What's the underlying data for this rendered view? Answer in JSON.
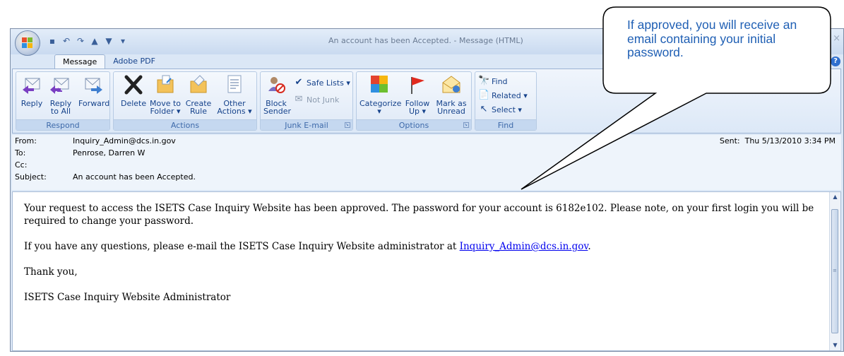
{
  "window": {
    "title": "An account has been Accepted. - Message (HTML)",
    "close_glyph": "×"
  },
  "quick_access": {
    "icons": [
      "save-icon",
      "undo-icon",
      "redo-icon",
      "previous-item-icon",
      "next-item-icon",
      "customize-dropdown-icon"
    ]
  },
  "tabs": [
    {
      "label": "Message",
      "active": true
    },
    {
      "label": "Adobe PDF",
      "active": false
    }
  ],
  "ribbon": {
    "respond": {
      "label": "Respond",
      "reply": "Reply",
      "reply_all": "Reply\nto All",
      "forward": "Forward"
    },
    "actions": {
      "label": "Actions",
      "delete": "Delete",
      "move": "Move to\nFolder ▾",
      "create_rule": "Create\nRule",
      "other_actions": "Other\nActions ▾"
    },
    "junk": {
      "label": "Junk E-mail",
      "block_sender": "Block\nSender",
      "safe_lists": "Safe Lists ▾",
      "not_junk": "Not Junk"
    },
    "options": {
      "label": "Options",
      "categorize": "Categorize\n▾",
      "follow_up": "Follow\nUp ▾",
      "mark_unread": "Mark as\nUnread"
    },
    "find": {
      "label": "Find",
      "find": "Find",
      "related": "Related ▾",
      "select": "Select ▾"
    }
  },
  "headers": {
    "from_label": "From:",
    "from_value": "Inquiry_Admin@dcs.in.gov",
    "to_label": "To:",
    "to_value": "Penrose, Darren W",
    "cc_label": "Cc:",
    "cc_value": "",
    "subject_label": "Subject:",
    "subject_value": "An account has been Accepted.",
    "sent_label": "Sent:",
    "sent_value": "Thu 5/13/2010 3:34 PM"
  },
  "body": {
    "para1": "Your request to access the ISETS Case Inquiry Website has been approved. The password for your account is 6182e102. Please note, on your first login you will be required to change your password.",
    "para2_before": "If you have any questions, please e-mail the ISETS Case Inquiry Website administrator at ",
    "para2_link": "Inquiry_Admin@dcs.in.gov",
    "para2_after": ".",
    "para3": "Thank you,",
    "para4": "ISETS Case Inquiry Website Administrator"
  },
  "callout": {
    "text": "If approved, you will receive an email containing your initial password."
  },
  "colors": {
    "callout_text": "#1f5fb4",
    "link": "#0000ee",
    "ribbon_text": "#15428b"
  }
}
